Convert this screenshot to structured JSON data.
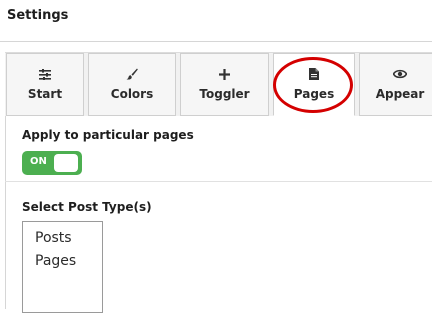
{
  "header": {
    "title": "Settings"
  },
  "tabs": [
    {
      "label": "Start",
      "icon": "sliders-icon"
    },
    {
      "label": "Colors",
      "icon": "paintbrush-icon"
    },
    {
      "label": "Toggler",
      "icon": "plus-icon"
    },
    {
      "label": "Pages",
      "icon": "document-icon",
      "active": true
    },
    {
      "label": "Appear",
      "icon": "eye-icon"
    }
  ],
  "pages_panel": {
    "apply_label": "Apply to particular pages",
    "toggle_text": "ON",
    "toggle_color": "#4caf50",
    "post_type_label": "Select Post Type(s)",
    "post_types": [
      "Posts",
      "Pages"
    ]
  },
  "annotation": {
    "color": "#d40000",
    "target": "Pages"
  }
}
